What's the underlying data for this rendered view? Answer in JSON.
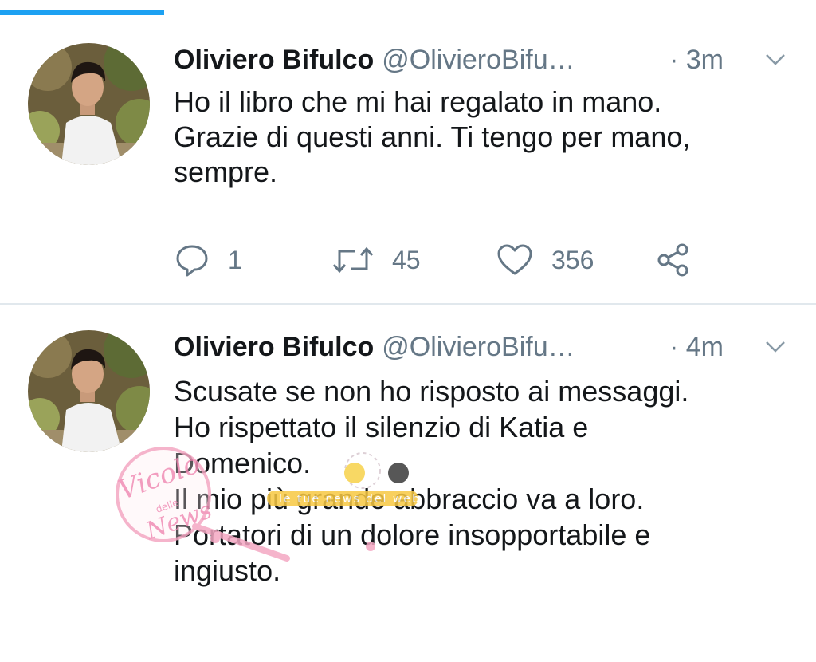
{
  "tweets": [
    {
      "name": "Oliviero Bifulco",
      "handle": "@OlivieroBifu…",
      "time": "· 3m",
      "lines": [
        "Ho il libro che mi hai regalato in mano.",
        "Grazie di questi anni. Ti tengo per mano,",
        "sempre."
      ],
      "replies": "1",
      "retweets": "45",
      "likes": "356"
    },
    {
      "name": "Oliviero Bifulco",
      "handle": "@OlivieroBifu…",
      "time": "· 4m",
      "lines": [
        "Scusate se non ho risposto ai messaggi.",
        "Ho rispettato il silenzio di Katia e",
        "Domenico.",
        "Il mio più grande abbraccio va a loro.",
        "Portatori di un dolore insopportabile e",
        "ingiusto."
      ]
    }
  ],
  "watermark": {
    "script_text": "Vicolo",
    "small_text": "delle",
    "script_text2": "News",
    "banner_text": "le tue news del web"
  },
  "colors": {
    "accent": "#1da1f2",
    "muted": "#657786",
    "text": "#14171a"
  },
  "icons": [
    "reply-icon",
    "retweet-icon",
    "like-icon",
    "share-icon",
    "chevron-down-icon"
  ]
}
